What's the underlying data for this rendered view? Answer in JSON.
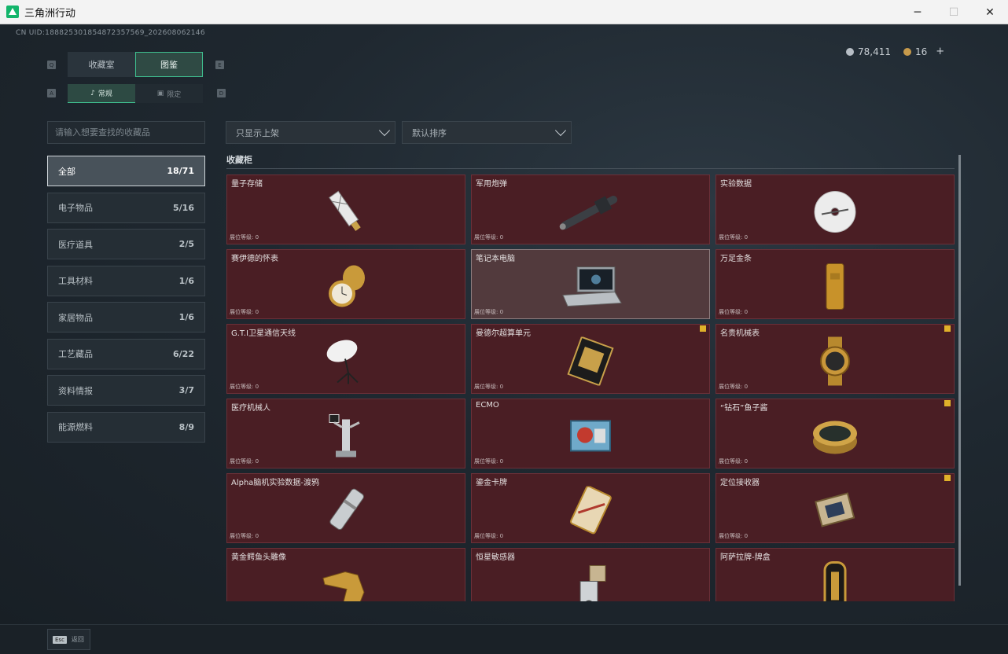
{
  "window": {
    "title": "三角洲行动",
    "minimize": "─",
    "maximize": "☐",
    "close": "✕"
  },
  "header": {
    "uid": "CN UID:1888253018548723575​69_202608062146",
    "currency": [
      {
        "icon": "silver-coin-icon",
        "value": "78,411"
      },
      {
        "icon": "gold-coin-icon",
        "value": "16"
      }
    ],
    "add_label": "+"
  },
  "keys": {
    "q": "Q",
    "e": "E",
    "a": "A",
    "d": "D"
  },
  "tabs_main": [
    {
      "label": "收藏室"
    },
    {
      "label": "图鉴"
    }
  ],
  "tabs_sub": [
    {
      "label": "常规"
    },
    {
      "label": "限定"
    }
  ],
  "search": {
    "placeholder": "请输入想要查找的收藏品"
  },
  "filters": {
    "shelf": "只显示上架",
    "sort": "默认排序"
  },
  "categories": [
    {
      "label": "全部",
      "count": "18/71"
    },
    {
      "label": "电子物品",
      "count": "5/16"
    },
    {
      "label": "医疗道具",
      "count": "2/5"
    },
    {
      "label": "工具材料",
      "count": "1/6"
    },
    {
      "label": "家居物品",
      "count": "1/6"
    },
    {
      "label": "工艺藏品",
      "count": "6/22"
    },
    {
      "label": "资料情报",
      "count": "3/7"
    },
    {
      "label": "能源燃料",
      "count": "8/9"
    }
  ],
  "section_title": "收藏柜",
  "level_label": "展位等级: 0",
  "items": [
    {
      "name": "量子存储",
      "flag": false
    },
    {
      "name": "军用炮弹",
      "flag": false
    },
    {
      "name": "实验数据",
      "flag": false
    },
    {
      "name": "赛伊德的怀表",
      "flag": false
    },
    {
      "name": "笔记本电脑",
      "flag": false
    },
    {
      "name": "万足金条",
      "flag": false
    },
    {
      "name": "G.T.I卫星通信天线",
      "flag": false
    },
    {
      "name": "曼德尔超算单元",
      "flag": true
    },
    {
      "name": "名贵机械表",
      "flag": true
    },
    {
      "name": "医疗机械人",
      "flag": false
    },
    {
      "name": "ECMO",
      "flag": false
    },
    {
      "name": "“钻石”鱼子酱",
      "flag": true
    },
    {
      "name": "Alpha脑机实验数据-渡鸦",
      "flag": false
    },
    {
      "name": "鎏金卡牌",
      "flag": false
    },
    {
      "name": "定位接收器",
      "flag": true
    },
    {
      "name": "黄金鳄鱼头雕像",
      "flag": false
    },
    {
      "name": "恒星敏感器",
      "flag": false
    },
    {
      "name": "阿萨拉牌-牌盒",
      "flag": false
    }
  ],
  "footer": {
    "esc_key": "Esc",
    "back_label": "返回"
  }
}
